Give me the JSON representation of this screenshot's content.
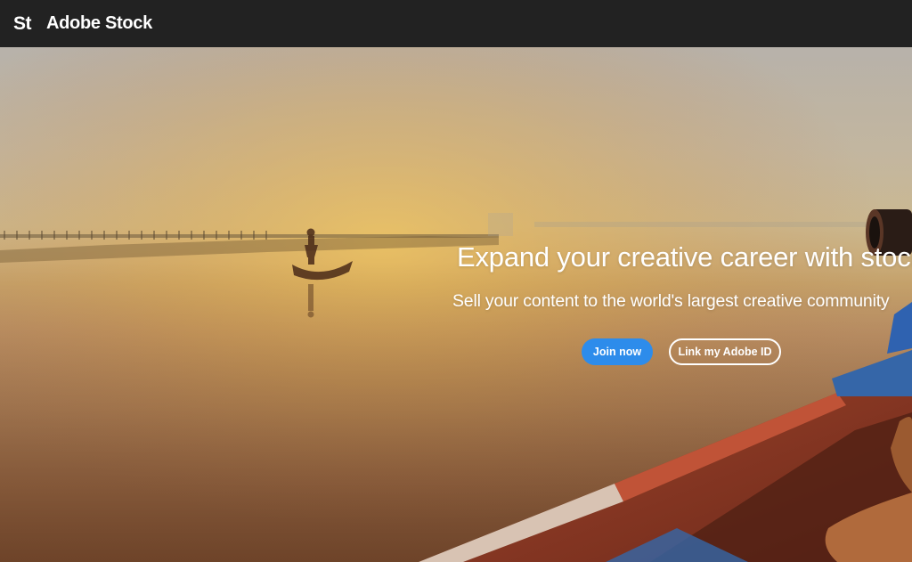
{
  "header": {
    "logo": "St",
    "brand": "Adobe Stock"
  },
  "hero": {
    "title": "Expand your creative career with stock",
    "subtitle": "Sell your content to the world's largest creative community",
    "join_button": "Join now",
    "link_button": "Link my Adobe ID"
  },
  "colors": {
    "topbar": "#222222",
    "primary_button": "#2d8ceb",
    "text": "#ffffff"
  }
}
